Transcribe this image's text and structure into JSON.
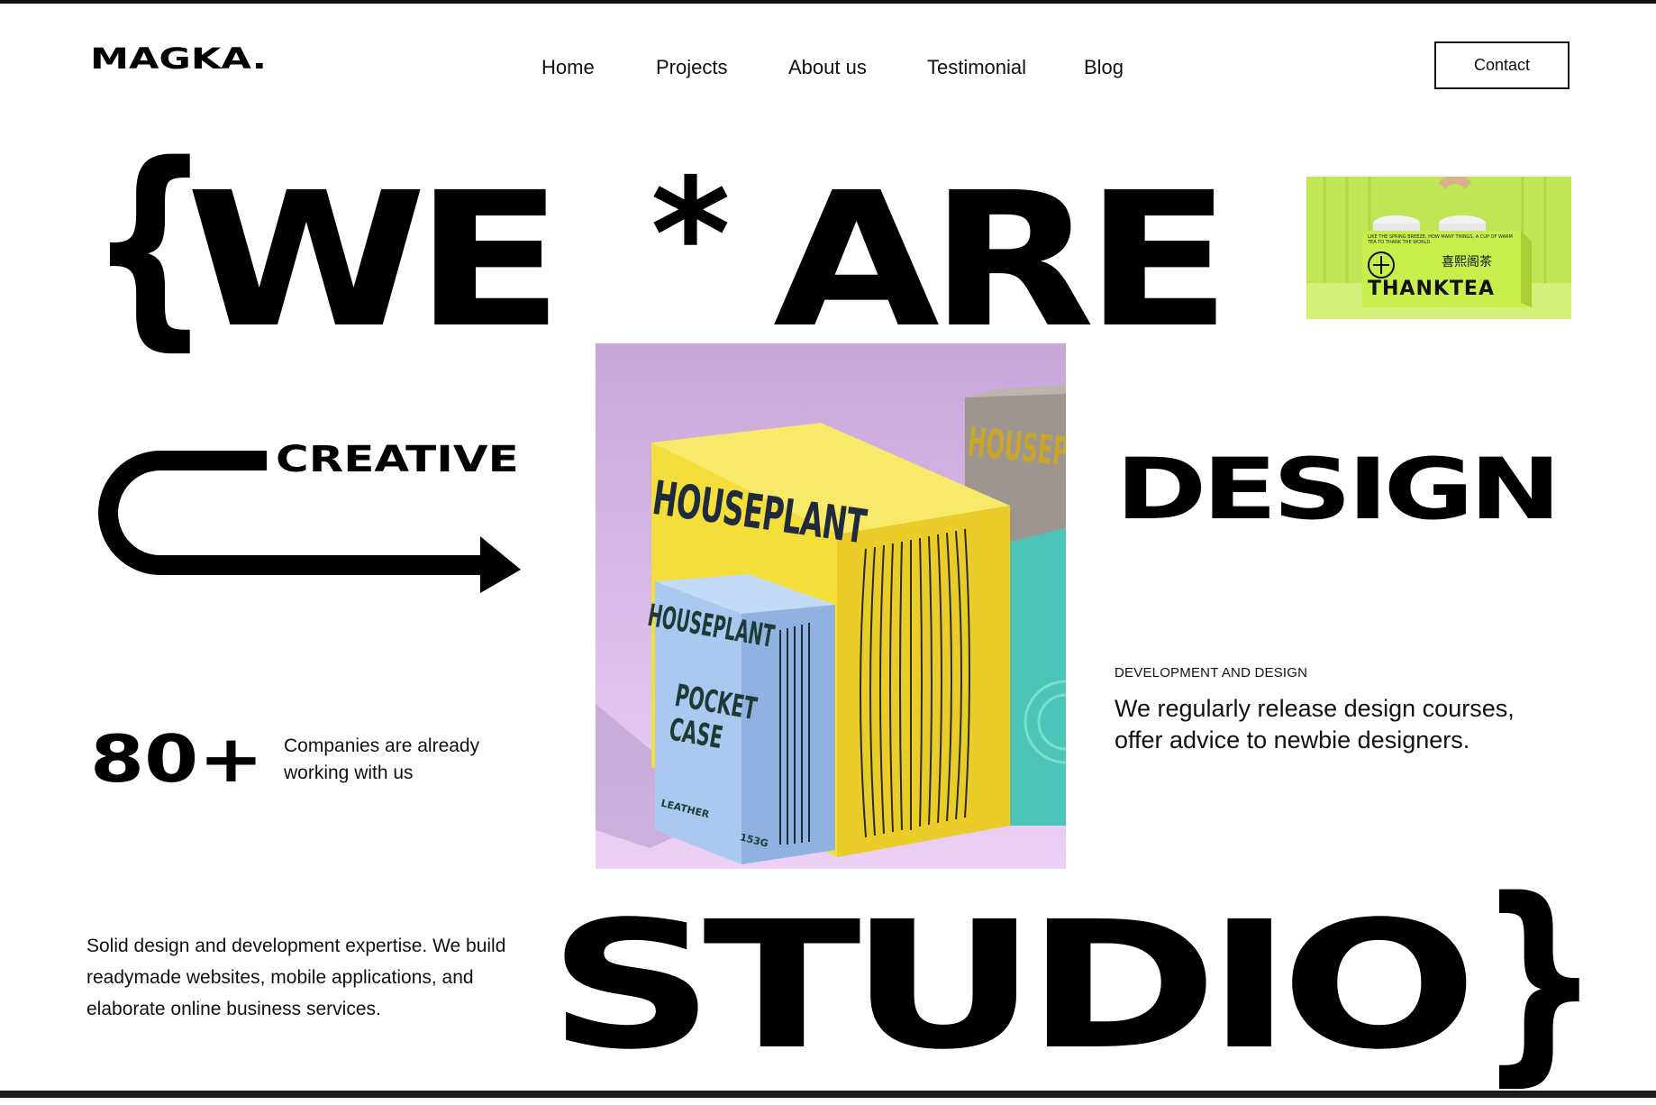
{
  "brand": {
    "logo": "MAGKA."
  },
  "nav": {
    "items": [
      {
        "label": "Home"
      },
      {
        "label": "Projects"
      },
      {
        "label": "About us"
      },
      {
        "label": "Testimonial"
      },
      {
        "label": "Blog"
      }
    ],
    "contact_label": "Contact"
  },
  "headline": {
    "open_brace": "{",
    "we": "WE",
    "star": "*",
    "are": "ARE",
    "creative": "CREATIVE",
    "design": "DESIGN",
    "studio": "STUDIO",
    "close_brace": "}"
  },
  "thumbnail": {
    "brand_text": "THANKTEA",
    "chinese_text": "喜熙阁茶",
    "small_text": "LIKE THE SPRING BREEZE, HOW MANY THINGS, A CUP OF WARM TEA TO THANK THE WORLD."
  },
  "hero_image": {
    "box_big_label": "HOUSEPLANT",
    "box_small_label": "HOUSEPLANT",
    "box_small_sub": "POCKET\nCASE",
    "box_small_material": "LEATHER",
    "box_small_weight": "153G",
    "box_back_label": "HOUSEP"
  },
  "stats": {
    "count": "80+",
    "label": "Companies are already working with us"
  },
  "development": {
    "eyebrow": "DEVELOPMENT AND DESIGN",
    "text": "We regularly release design courses, offer advice to newbie designers."
  },
  "intro": {
    "text": "Solid design and development expertise. We build readymade websites, mobile applications, and elaborate online business services."
  },
  "colors": {
    "box_yellow": "#f4de3a",
    "box_blue": "#aac8f0",
    "box_teal": "#5fcfc3",
    "background_lilac": "#d4b5e6",
    "tea_green": "#c3e85a"
  }
}
